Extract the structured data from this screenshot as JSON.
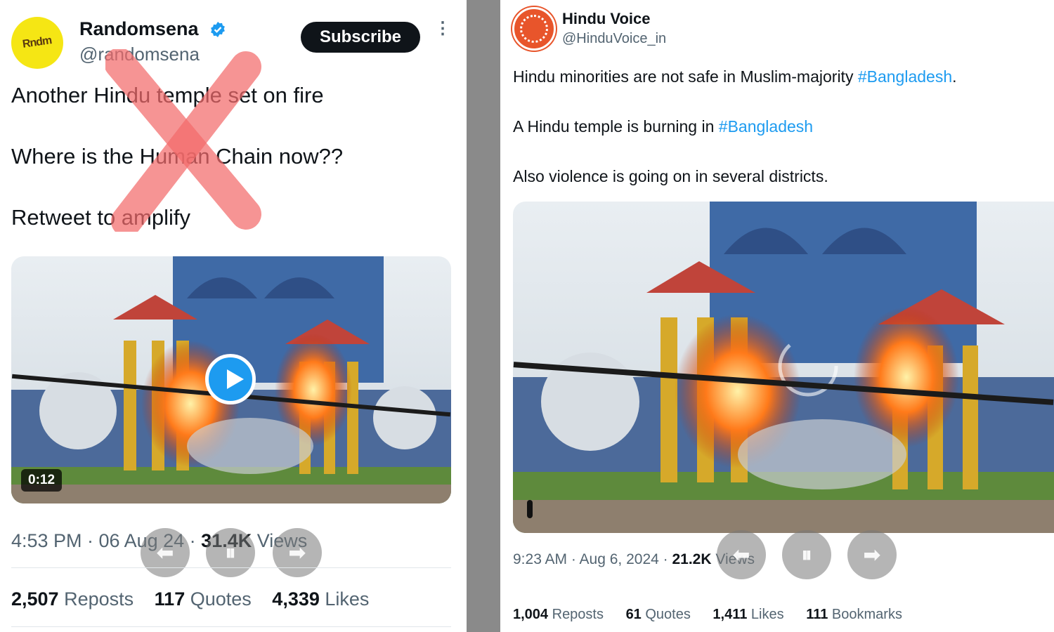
{
  "left_tweet": {
    "avatar_text": "Rndm",
    "author_name": "Randomsena",
    "author_handle": "@randomsena",
    "subscribe_label": "Subscribe",
    "more_icon": "⋮",
    "lines": [
      "Another Hindu temple set on fire",
      "Where is the Human Chain now??",
      "Retweet to amplify"
    ],
    "video_duration": "0:12",
    "meta_time": "4:53 PM · 06 Aug 24 · ",
    "meta_views_count": "31.4K",
    "meta_views_label": " Views",
    "stats": [
      {
        "count": "2,507",
        "label": " Reposts"
      },
      {
        "count": "117",
        "label": " Quotes"
      },
      {
        "count": "4,339",
        "label": " Likes"
      }
    ],
    "player_controls": [
      "⬅",
      "⏸",
      "➡"
    ]
  },
  "right_tweet": {
    "author_name": "Hindu Voice",
    "author_handle": "@HinduVoice_in",
    "line1_text": "Hindu minorities are not safe in Muslim-majority ",
    "line1_tag": "#Bangladesh",
    "line1_end": ".",
    "line2_text": "A Hindu temple is burning in ",
    "line2_tag": "#Bangladesh",
    "line3_text": "Also violence is going on in several districts.",
    "meta_time": "9:23 AM · Aug 6, 2024 · ",
    "meta_views_count": "21.2K",
    "meta_views_label": " Views",
    "stats": [
      {
        "count": "1,004",
        "label": " Reposts"
      },
      {
        "count": "61",
        "label": " Quotes"
      },
      {
        "count": "1,411",
        "label": " Likes"
      },
      {
        "count": "111",
        "label": " Bookmarks"
      }
    ],
    "player_controls": [
      "⬅",
      "⏸",
      "➡"
    ]
  },
  "colors": {
    "link": "#1d9bf0",
    "fake_mark": "#f26b6b",
    "divider": "#8a8a8a"
  }
}
